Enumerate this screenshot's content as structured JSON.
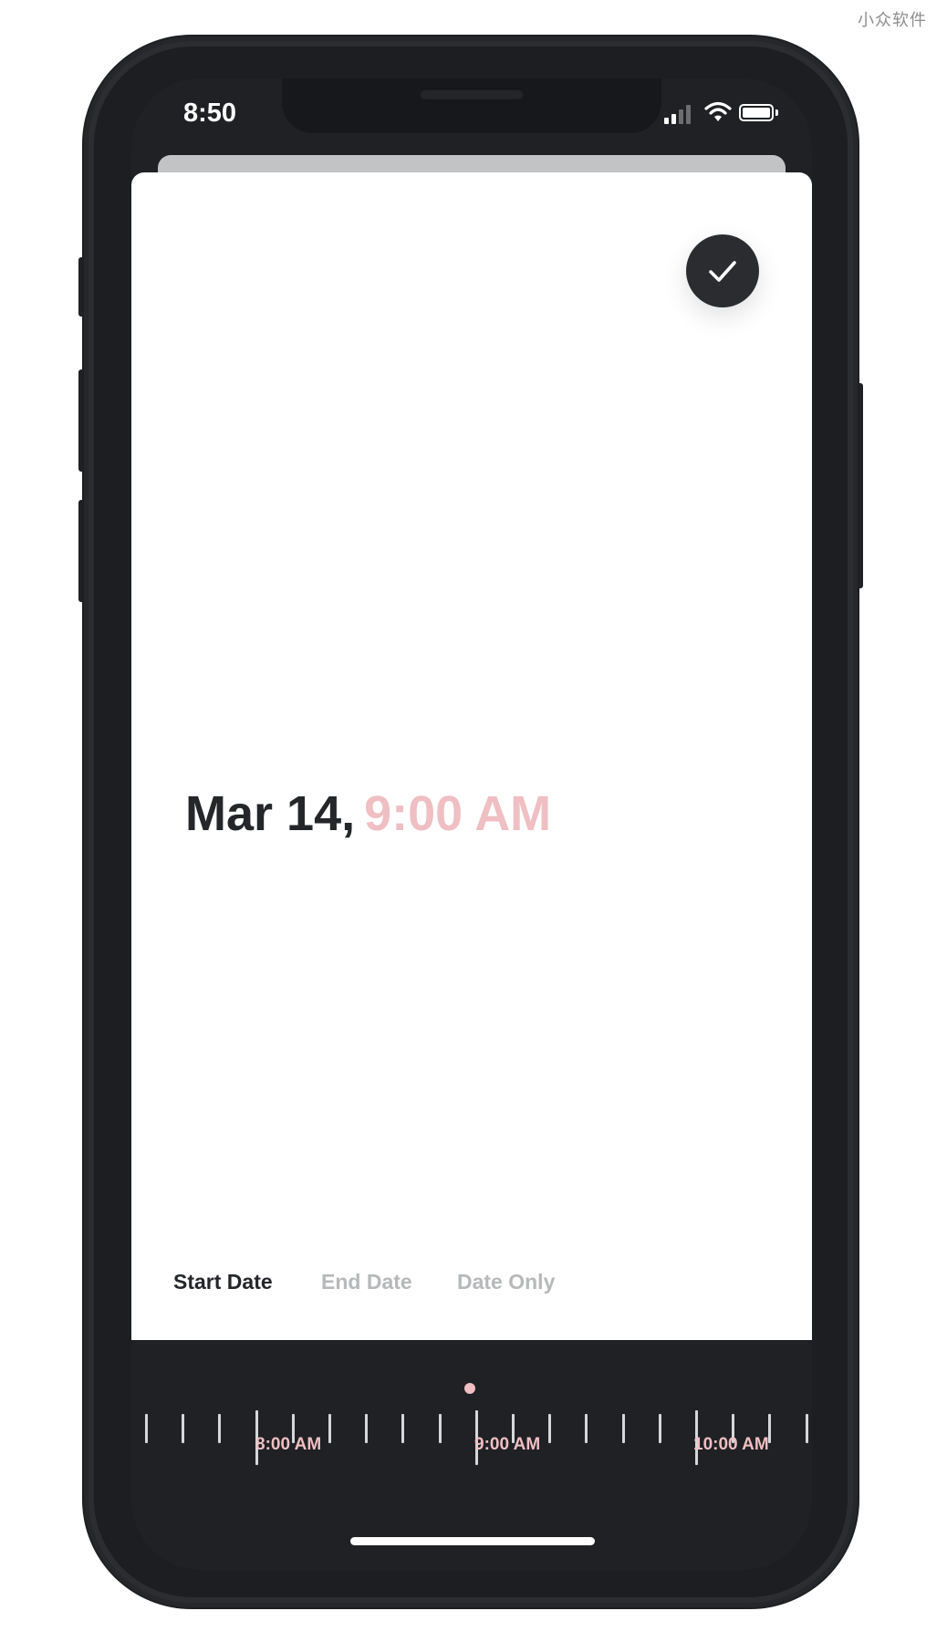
{
  "watermark": "小众软件",
  "status_bar": {
    "time": "8:50",
    "signal_icon": "cellular-signal-icon",
    "wifi_icon": "wifi-icon",
    "battery_icon": "battery-icon"
  },
  "confirm_button": {
    "icon": "checkmark-icon"
  },
  "selection": {
    "date": "Mar 14,",
    "time": "9:00 AM"
  },
  "mode_tabs": [
    {
      "label": "Start Date",
      "active": true
    },
    {
      "label": "End Date",
      "active": false
    },
    {
      "label": "Date Only",
      "active": false
    }
  ],
  "time_ruler": {
    "labels": [
      "8:00 AM",
      "9:00 AM",
      "10:00 AM"
    ],
    "selected_value": "9:00 AM"
  },
  "colors": {
    "accent": "#efbfc3",
    "dark": "#24262a",
    "inactive": "#b7b8ba"
  }
}
